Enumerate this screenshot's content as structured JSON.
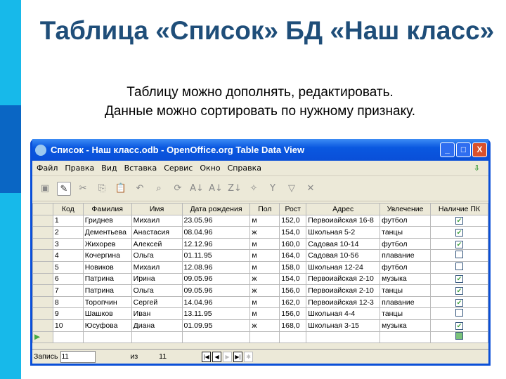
{
  "slide": {
    "title": "Таблица «Список»  БД «Наш класс»",
    "subtitle_lines": [
      "Таблицу можно дополнять, редактировать.",
      "Данные можно сортировать по нужному признаку."
    ]
  },
  "window": {
    "title": "Список - Наш класс.odb - OpenOffice.org Table Data View",
    "controls": [
      "_",
      "□",
      "X"
    ]
  },
  "menu": [
    "Файл",
    "Правка",
    "Вид",
    "Вставка",
    "Сервис",
    "Окно",
    "Справка"
  ],
  "toolbar": [
    "save-icon",
    "edit-icon",
    "cut-icon",
    "copy-icon",
    "paste-icon",
    "undo-icon",
    "find-icon",
    "refresh-icon",
    "sort-asc-icon",
    "sort-az-icon",
    "sort-za-icon",
    "autofilter-icon",
    "standard-filter-icon",
    "filter-icon",
    "remove-filter-icon"
  ],
  "table": {
    "columns": [
      "Код",
      "Фамилия",
      "Имя",
      "Дата рождения",
      "Пол",
      "Рост",
      "Адрес",
      "Увлечение",
      "Наличие ПК"
    ],
    "rows": [
      [
        "1",
        "Гриднев",
        "Михаил",
        "23.05.96",
        "м",
        "152,0",
        "Первоиайская 16-8",
        "футбол",
        true
      ],
      [
        "2",
        "Дементьева",
        "Анастасия",
        "08.04.96",
        "ж",
        "154,0",
        "Школьная 5-2",
        "танцы",
        true
      ],
      [
        "3",
        "Жихорев",
        "Алексей",
        "12.12.96",
        "м",
        "160,0",
        "Садовая 10-14",
        "футбол",
        true
      ],
      [
        "4",
        "Кочергина",
        "Ольга",
        "01.11.95",
        "м",
        "164,0",
        "Садовая 10-56",
        "плавание",
        false
      ],
      [
        "5",
        "Новиков",
        "Михаил",
        "12.08.96",
        "м",
        "158,0",
        "Школьная 12-24",
        "футбол",
        false
      ],
      [
        "6",
        "Патрина",
        "Ирина",
        "09.05.96",
        "ж",
        "154,0",
        "Первоиайская 2-10",
        "музыка",
        true
      ],
      [
        "7",
        "Патрина",
        "Ольга",
        "09.05.96",
        "ж",
        "156,0",
        "Первоиайская 2-10",
        "танцы",
        true
      ],
      [
        "8",
        "Торопчин",
        "Сергей",
        "14.04.96",
        "м",
        "162,0",
        "Первоиайская 12-3",
        "плавание",
        true
      ],
      [
        "9",
        "Шашков",
        "Иван",
        "13.11.95",
        "м",
        "156,0",
        "Школьная 4-4",
        "танцы",
        false
      ],
      [
        "10",
        "Юсуфова",
        "Диана",
        "01.09.95",
        "ж",
        "168,0",
        "Школьная 3-15",
        "музыка",
        true
      ]
    ]
  },
  "status": {
    "record_label": "Запись",
    "record_value": "11",
    "of_label": "из",
    "total": "11"
  }
}
